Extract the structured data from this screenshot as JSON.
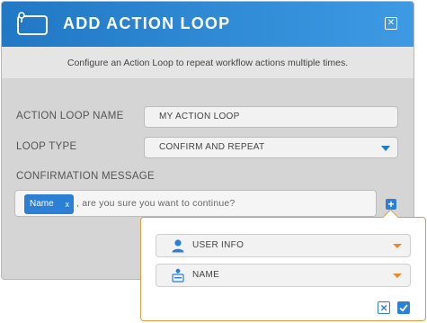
{
  "dialog": {
    "title": "ADD ACTION LOOP",
    "description": "Configure an Action Loop to repeat workflow actions multiple times.",
    "header_icon": "loop-window-icon",
    "close_icon": "close-icon"
  },
  "fields": {
    "name_label": "ACTION LOOP NAME",
    "name_value": "MY ACTION LOOP",
    "type_label": "LOOP TYPE",
    "type_value": "CONFIRM AND REPEAT",
    "message_label": "CONFIRMATION MESSAGE",
    "message_chip": "Name",
    "message_chip_remove": "x",
    "message_text": ", are you sure you want to continue?"
  },
  "popover": {
    "source_value": "USER INFO",
    "source_icon": "user-icon",
    "field_value": "NAME",
    "field_icon": "text-field-icon",
    "cancel_icon": "close-icon",
    "confirm_icon": "checkmark-icon"
  },
  "colors": {
    "header_start": "#2178c4",
    "header_end": "#3d9ae3",
    "accent_blue": "#2b7fd4",
    "accent_orange": "#e8892c"
  }
}
